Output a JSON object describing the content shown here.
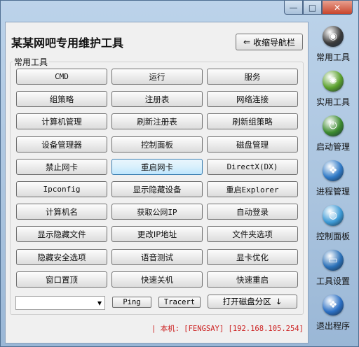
{
  "window": {
    "caption": {
      "minimize": "—",
      "maximize": "□",
      "close": "✕"
    }
  },
  "header": {
    "title": "某某网吧专用维护工具",
    "collapse_label": "收缩导航栏",
    "collapse_icon": "⇐"
  },
  "group_label": "常用工具",
  "buttons": [
    "CMD",
    "运行",
    "服务",
    "组策略",
    "注册表",
    "网络连接",
    "计算机管理",
    "刷新注册表",
    "刷新组策略",
    "设备管理器",
    "控制面板",
    "磁盘管理",
    "禁止网卡",
    "重启网卡",
    "DirectX(DX)",
    "Ipconfig",
    "显示隐藏设备",
    "重启Explorer",
    "计算机名",
    "获取公网IP",
    "自动登录",
    "显示隐藏文件",
    "更改IP地址",
    "文件夹选项",
    "隐藏安全选项",
    "语音测试",
    "显卡优化",
    "窗口置顶",
    "快速关机",
    "快速重启"
  ],
  "bottom": {
    "combo_value": "",
    "combo_arrow": "▾",
    "ping": "Ping",
    "tracert": "Tracert",
    "disk_label": "打开磁盘分区",
    "disk_arrow": "↓"
  },
  "status": "| 本机: [FENGSAY] [192.168.105.254]",
  "sidebar": [
    {
      "label": "常用工具",
      "icon": "cd-icon",
      "color": "#3a3a3a"
    },
    {
      "label": "实用工具",
      "icon": "gear-icon",
      "color": "#5aa02c"
    },
    {
      "label": "启动管理",
      "icon": "power-icon",
      "color": "#3b8a2e"
    },
    {
      "label": "进程管理",
      "icon": "windows-icon",
      "color": "#2f79c6"
    },
    {
      "label": "控制面板",
      "icon": "globe-icon",
      "color": "#3c9ad6"
    },
    {
      "label": "工具设置",
      "icon": "monitor-icon",
      "color": "#2a70b8"
    },
    {
      "label": "退出程序",
      "icon": "windows-logo-icon",
      "color": "#2a6fc4"
    }
  ]
}
